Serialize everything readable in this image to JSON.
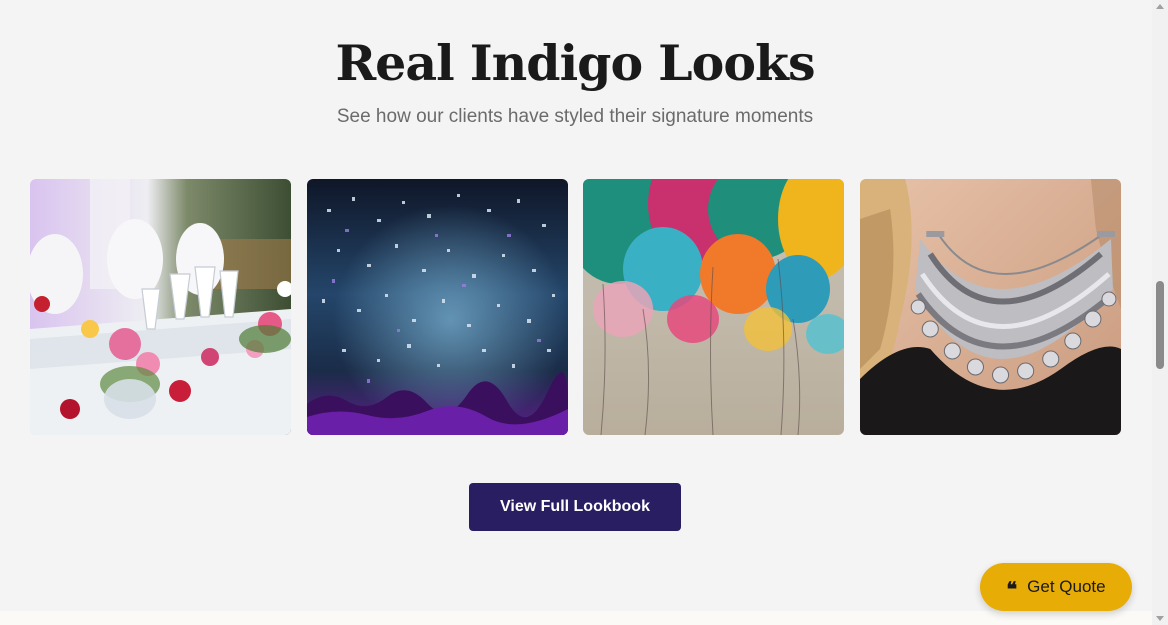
{
  "section": {
    "title": "Real Indigo Looks",
    "subtitle": "See how our clients have styled their signature moments"
  },
  "gallery": {
    "items": [
      {
        "subject": "wedding-table-setting"
      },
      {
        "subject": "concert-confetti"
      },
      {
        "subject": "colorful-balloons"
      },
      {
        "subject": "silver-statement-necklace"
      }
    ]
  },
  "cta": {
    "label": "View Full Lookbook"
  },
  "floating": {
    "quote_label": "Get Quote",
    "icon": "quote-icon"
  },
  "colors": {
    "primary": "#2a1e63",
    "accent": "#e8ac07",
    "background": "#f4f4f4"
  }
}
